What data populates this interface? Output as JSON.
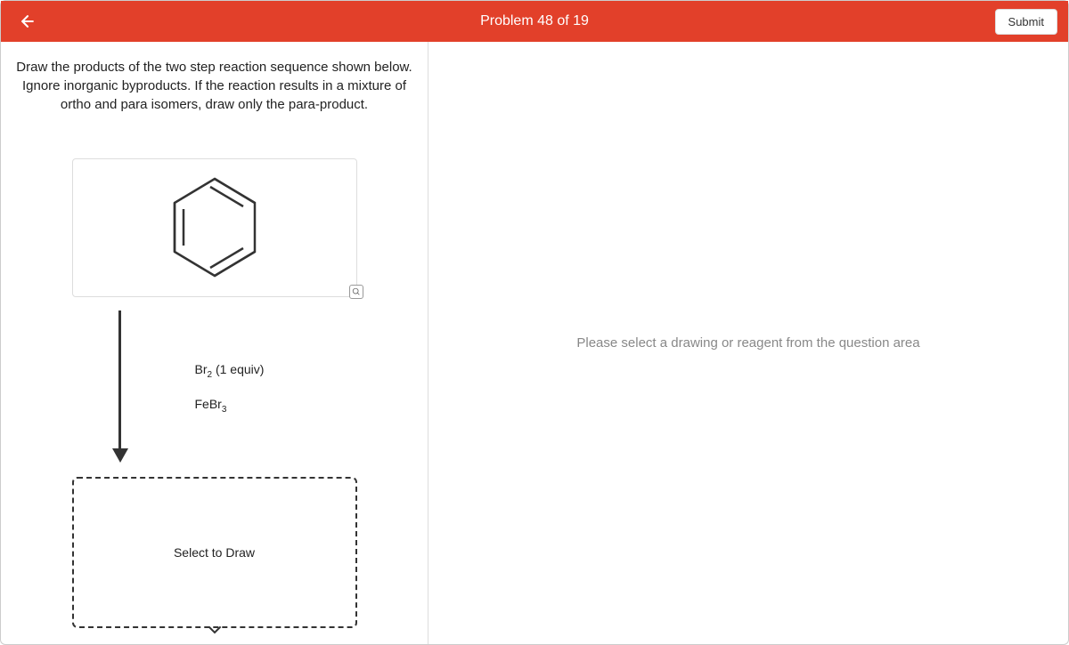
{
  "header": {
    "title": "Problem 48 of 19",
    "submit_label": "Submit"
  },
  "instructions": "Draw the products of the two step reaction sequence shown below. Ignore inorganic byproducts. If the reaction results in a mixture of ortho and para isomers, draw only the para-product.",
  "reagents": {
    "line1_prefix": "Br",
    "line1_sub": "2",
    "line1_suffix": " (1 equiv)",
    "line2_prefix": "FeBr",
    "line2_sub": "3"
  },
  "drop_box_label": "Select to Draw",
  "right_panel_message": "Please select a drawing or reagent from the question area"
}
